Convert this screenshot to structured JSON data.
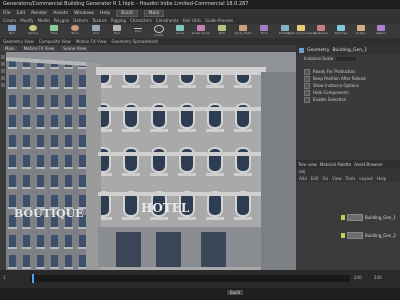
{
  "window": {
    "title": "Generators/Commercial Building Generator R 1.hiplc - Houdini Indie Limited-Commercial 18.0.287"
  },
  "menubar": {
    "items": [
      "File",
      "Edit",
      "Render",
      "Assets",
      "Windows",
      "Help"
    ],
    "desktop": "Build",
    "selected_label": "Main"
  },
  "shelf": {
    "tabs": [
      "Create",
      "Modify",
      "Model",
      "Polygon",
      "Deform",
      "Texture",
      "Rigging",
      "Characters",
      "Constraints",
      "Hair Utils",
      "Guide Process",
      "Terrain FX",
      "Simple FX"
    ],
    "tools": [
      "Box",
      "Sphere",
      "Tube",
      "Torus",
      "Grid",
      "Null",
      "Line",
      "Circle",
      "Curve",
      "Draw Curve",
      "Path",
      "Spray Paint",
      "Font",
      "Platonic",
      "L-System",
      "Metaball",
      "File"
    ],
    "right_tabs": [
      "Lights and Cameras",
      "Collisions",
      "Particles",
      "Grains",
      "Vellum"
    ]
  },
  "pathbar": {
    "items": [
      "Geometry View",
      "Composite View",
      "Motion FX View",
      "Geometry Spreadsheet"
    ]
  },
  "viewport": {
    "tabs": [
      "Main",
      "Motion FX View",
      "Scene View"
    ],
    "sign_left": "BOUTIQUE",
    "sign_hotel": "HOTEL"
  },
  "parameters": {
    "node_label": "Geometry",
    "node_name": "Building_Gen_1",
    "path": "/obj/Building_Gen_1",
    "rows": [
      "Instance Scale",
      "Ready For Production",
      "Keep Position After Reload",
      "Show Instance Options",
      "Hide Components",
      "Enable Selection"
    ]
  },
  "network": {
    "tabs": [
      "Tree view",
      "Material Palette",
      "Asset Browser"
    ],
    "path": "obj",
    "toolbar": [
      "Add",
      "Edit",
      "Go",
      "View",
      "Tools",
      "Layout",
      "Help"
    ],
    "nodes": [
      "Building_Gen_1",
      "Building_Gen_2"
    ]
  },
  "timeline": {
    "start": "1",
    "end": "240",
    "current": "1",
    "end2": "240"
  },
  "status": {
    "text": "Build"
  }
}
